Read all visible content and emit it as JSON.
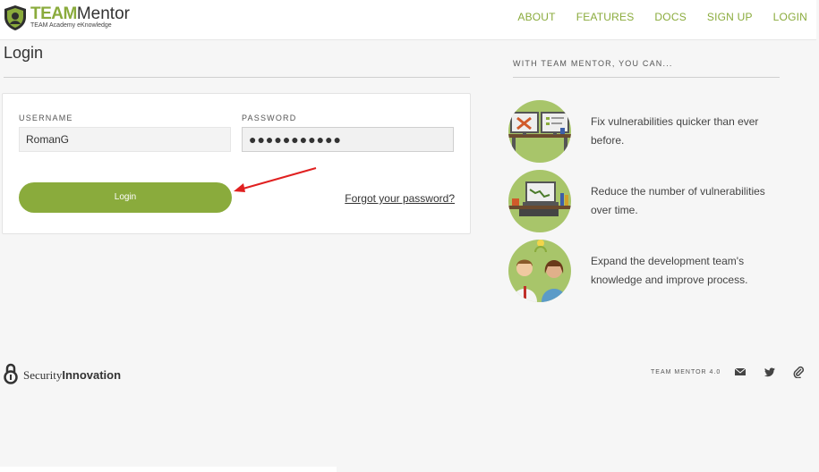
{
  "brand": {
    "name_part1": "TEAM",
    "name_part2": "Mentor",
    "tagline": "TEAM Academy eKnowledge"
  },
  "nav": {
    "items": [
      "ABOUT",
      "FEATURES",
      "DOCS",
      "SIGN UP",
      "LOGIN"
    ]
  },
  "page": {
    "title": "Login"
  },
  "form": {
    "username_label": "USERNAME",
    "username_value": "RomanG",
    "password_label": "PASSWORD",
    "password_value": "●●●●●●●●●●●",
    "login_label": "Login",
    "forgot_label": "Forgot your password?"
  },
  "features": {
    "heading": "WITH TEAM MENTOR, YOU CAN...",
    "items": [
      {
        "text": "Fix vulnerabilities quicker than ever before.",
        "icon": "workstation-tools-icon"
      },
      {
        "text": "Reduce the number of vulnerabilities over time.",
        "icon": "laptop-chart-icon"
      },
      {
        "text": "Expand the development team's knowledge and improve process.",
        "icon": "team-people-icon"
      }
    ]
  },
  "footer": {
    "company_part1": "Security",
    "company_part2": "Innovation",
    "version": "TEAM MENTOR 4.0",
    "icons": [
      "email-icon",
      "twitter-icon",
      "attachment-icon"
    ]
  },
  "colors": {
    "accent": "#8aab3c",
    "annotation_arrow": "#e02020",
    "feature_circle": "#a8c56a"
  }
}
